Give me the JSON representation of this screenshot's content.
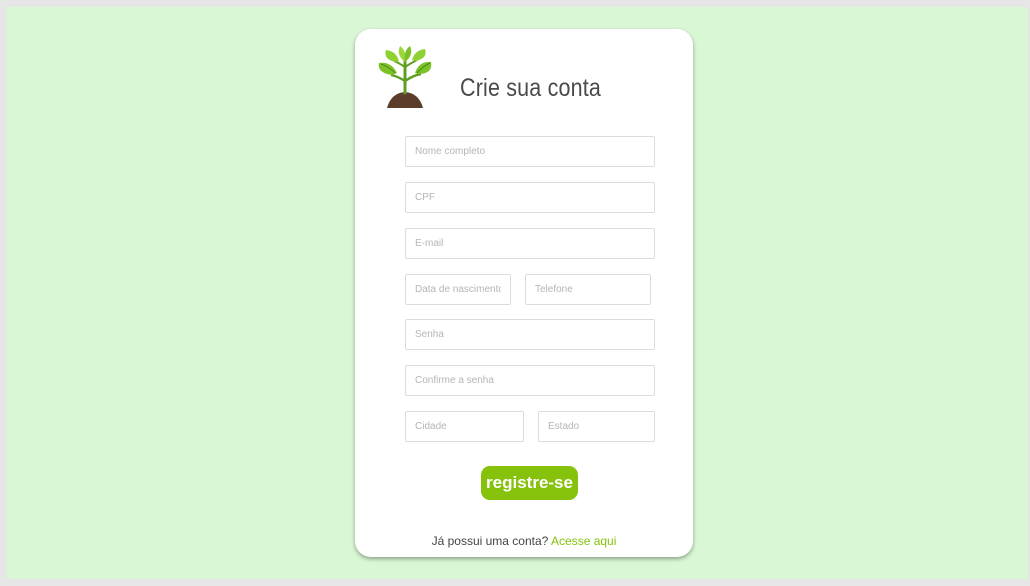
{
  "form": {
    "title": "Crie sua conta",
    "fields": {
      "full_name": {
        "placeholder": "Nome completo",
        "value": ""
      },
      "cpf": {
        "placeholder": "CPF",
        "value": ""
      },
      "email": {
        "placeholder": "E-mail",
        "value": ""
      },
      "birth_date": {
        "placeholder": "Data de nascimento",
        "value": ""
      },
      "phone": {
        "placeholder": "Telefone",
        "value": ""
      },
      "password": {
        "placeholder": "Senha",
        "value": ""
      },
      "confirm_password": {
        "placeholder": "Confirme a senha",
        "value": ""
      },
      "city": {
        "placeholder": "Cidade",
        "value": ""
      },
      "state": {
        "placeholder": "Estado",
        "value": ""
      }
    },
    "submit_label": "registre-se",
    "login_prompt": "Já possui uma conta?",
    "login_link": "Acesse aqui"
  },
  "icons": {
    "logo": "plant-sprout-icon"
  },
  "colors": {
    "page_background": "#d9f7d4",
    "card_background": "#ffffff",
    "accent": "#86c20b",
    "title_text": "#4a4a4a"
  }
}
